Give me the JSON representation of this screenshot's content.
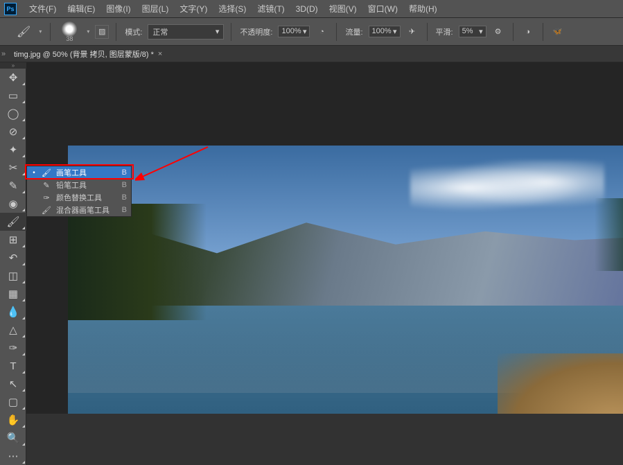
{
  "app": {
    "logo": "Ps"
  },
  "menubar": {
    "items": [
      {
        "label": "文件(F)"
      },
      {
        "label": "编辑(E)"
      },
      {
        "label": "图像(I)"
      },
      {
        "label": "图层(L)"
      },
      {
        "label": "文字(Y)"
      },
      {
        "label": "选择(S)"
      },
      {
        "label": "滤镜(T)"
      },
      {
        "label": "3D(D)"
      },
      {
        "label": "视图(V)"
      },
      {
        "label": "窗口(W)"
      },
      {
        "label": "帮助(H)"
      }
    ]
  },
  "optionsbar": {
    "brush_size": "38",
    "mode_label": "模式:",
    "mode_value": "正常",
    "opacity_label": "不透明度:",
    "opacity_value": "100%",
    "flow_label": "流量:",
    "flow_value": "100%",
    "smoothing_label": "平滑:",
    "smoothing_value": "5%"
  },
  "tab": {
    "title": "timg.jpg @ 50% (背景 拷贝, 图层蒙版/8) *"
  },
  "toolbar": {
    "tools": [
      {
        "name": "move-tool",
        "glyph": "✥"
      },
      {
        "name": "marquee-tool",
        "glyph": "▭"
      },
      {
        "name": "lasso-tool",
        "glyph": "◯"
      },
      {
        "name": "quick-select-tool",
        "glyph": "⊘"
      },
      {
        "name": "magic-wand-tool",
        "glyph": "✦"
      },
      {
        "name": "crop-tool",
        "glyph": "✂"
      },
      {
        "name": "eyedropper-tool",
        "glyph": "✎"
      },
      {
        "name": "healing-brush-tool",
        "glyph": "◉"
      },
      {
        "name": "brush-tool",
        "glyph": "🖌",
        "active": true
      },
      {
        "name": "clone-stamp-tool",
        "glyph": "⊞"
      },
      {
        "name": "history-brush-tool",
        "glyph": "↶"
      },
      {
        "name": "eraser-tool",
        "glyph": "◫"
      },
      {
        "name": "gradient-tool",
        "glyph": "▦"
      },
      {
        "name": "blur-tool",
        "glyph": "💧"
      },
      {
        "name": "dodge-tool",
        "glyph": "△"
      },
      {
        "name": "pen-tool",
        "glyph": "✑"
      },
      {
        "name": "type-tool",
        "glyph": "T"
      },
      {
        "name": "path-select-tool",
        "glyph": "↖"
      },
      {
        "name": "shape-tool",
        "glyph": "▢"
      },
      {
        "name": "hand-tool",
        "glyph": "✋"
      },
      {
        "name": "zoom-tool",
        "glyph": "🔍"
      },
      {
        "name": "edit-toolbar",
        "glyph": "⋯"
      }
    ]
  },
  "flyout": {
    "items": [
      {
        "label": "画笔工具",
        "shortcut": "B",
        "selected": true,
        "icon": "🖌"
      },
      {
        "label": "铅笔工具",
        "shortcut": "B",
        "icon": "✎"
      },
      {
        "label": "颜色替换工具",
        "shortcut": "B",
        "icon": "✑"
      },
      {
        "label": "混合器画笔工具",
        "shortcut": "B",
        "icon": "🖌"
      }
    ]
  }
}
